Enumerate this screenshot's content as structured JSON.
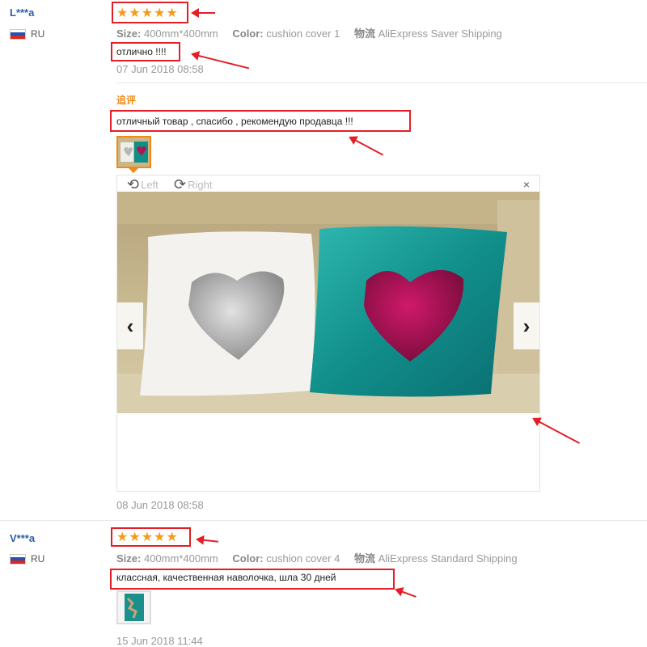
{
  "review1": {
    "user": "L***a",
    "country": "RU",
    "rating": 5,
    "size_label": "Size:",
    "size_value": "400mm*400mm",
    "color_label": "Color:",
    "color_value": "cushion cover 1",
    "shipping_label": "物流",
    "shipping_value": "AliExpress Saver Shipping",
    "text": "отлично !!!!",
    "date": "07 Jun 2018 08:58",
    "additional_label": "追评",
    "additional_text": "отличный товар , спасибо , рекомендую продавца !!!",
    "additional_date": "08 Jun 2018 08:58"
  },
  "viewer": {
    "rotate_left": "Left",
    "rotate_right": "Right",
    "close": "×",
    "prev": "‹",
    "next": "›"
  },
  "review2": {
    "user": "V***a",
    "country": "RU",
    "rating": 5,
    "size_label": "Size:",
    "size_value": "400mm*400mm",
    "color_label": "Color:",
    "color_value": "cushion cover 4",
    "shipping_label": "物流",
    "shipping_value": "AliExpress Standard Shipping",
    "text": "классная, качественная наволочка, шла 30 дней",
    "date": "15 Jun 2018 11:44"
  },
  "icons": {
    "star": "star-icon",
    "flag": "russia-flag-icon",
    "rotate_left": "rotate-left-icon",
    "rotate_right": "rotate-right-icon",
    "close": "close-icon",
    "prev": "chevron-left-icon",
    "next": "chevron-right-icon",
    "annotation": "red-arrow-annotation"
  },
  "colors": {
    "accent": "#f59a1b",
    "username": "#2b5fa8",
    "annotation": "#e41e26",
    "followup": "#f08a17"
  }
}
